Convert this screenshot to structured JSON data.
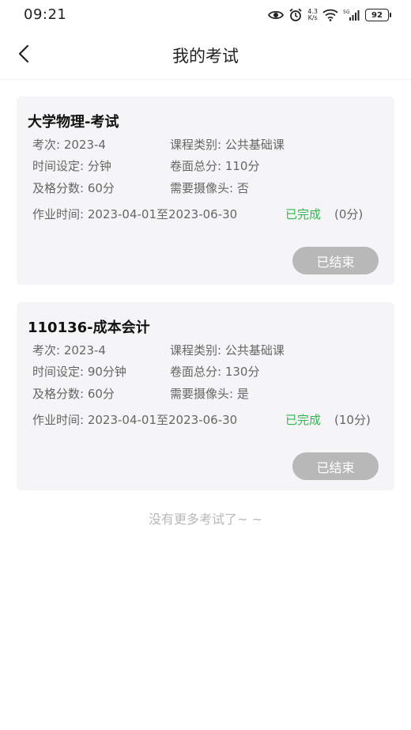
{
  "status_bar": {
    "time": "09:21",
    "network_speed_value": "4.3",
    "network_speed_unit": "K/s",
    "battery_level": "92"
  },
  "header": {
    "title": "我的考试"
  },
  "exams": [
    {
      "title": "大学物理-考试",
      "session_label": "考次:",
      "session_value": "2023-4",
      "course_type_label": "课程类别:",
      "course_type_value": "公共基础课",
      "time_setting_label": "时间设定:",
      "time_setting_value": "分钟",
      "total_score_label": "卷面总分:",
      "total_score_value": "110分",
      "pass_score_label": "及格分数:",
      "pass_score_value": "60分",
      "camera_label": "需要摄像头:",
      "camera_value": "否",
      "work_time_label": "作业时间:",
      "work_time_value": "2023-04-01至2023-06-30",
      "status": "已完成",
      "score": "(0分)",
      "action_label": "已结束"
    },
    {
      "title": "110136-成本会计",
      "session_label": "考次:",
      "session_value": "2023-4",
      "course_type_label": "课程类别:",
      "course_type_value": "公共基础课",
      "time_setting_label": "时间设定:",
      "time_setting_value": "90分钟",
      "total_score_label": "卷面总分:",
      "total_score_value": "130分",
      "pass_score_label": "及格分数:",
      "pass_score_value": "60分",
      "camera_label": "需要摄像头:",
      "camera_value": "是",
      "work_time_label": "作业时间:",
      "work_time_value": "2023-04-01至2023-06-30",
      "status": "已完成",
      "score": "(10分)",
      "action_label": "已结束"
    }
  ],
  "footer": {
    "no_more_text": "没有更多考试了~ ~"
  },
  "colors": {
    "status_done": "#2db84d",
    "card_background": "#f5f5f7",
    "ended_button": "#b8b8b8"
  }
}
